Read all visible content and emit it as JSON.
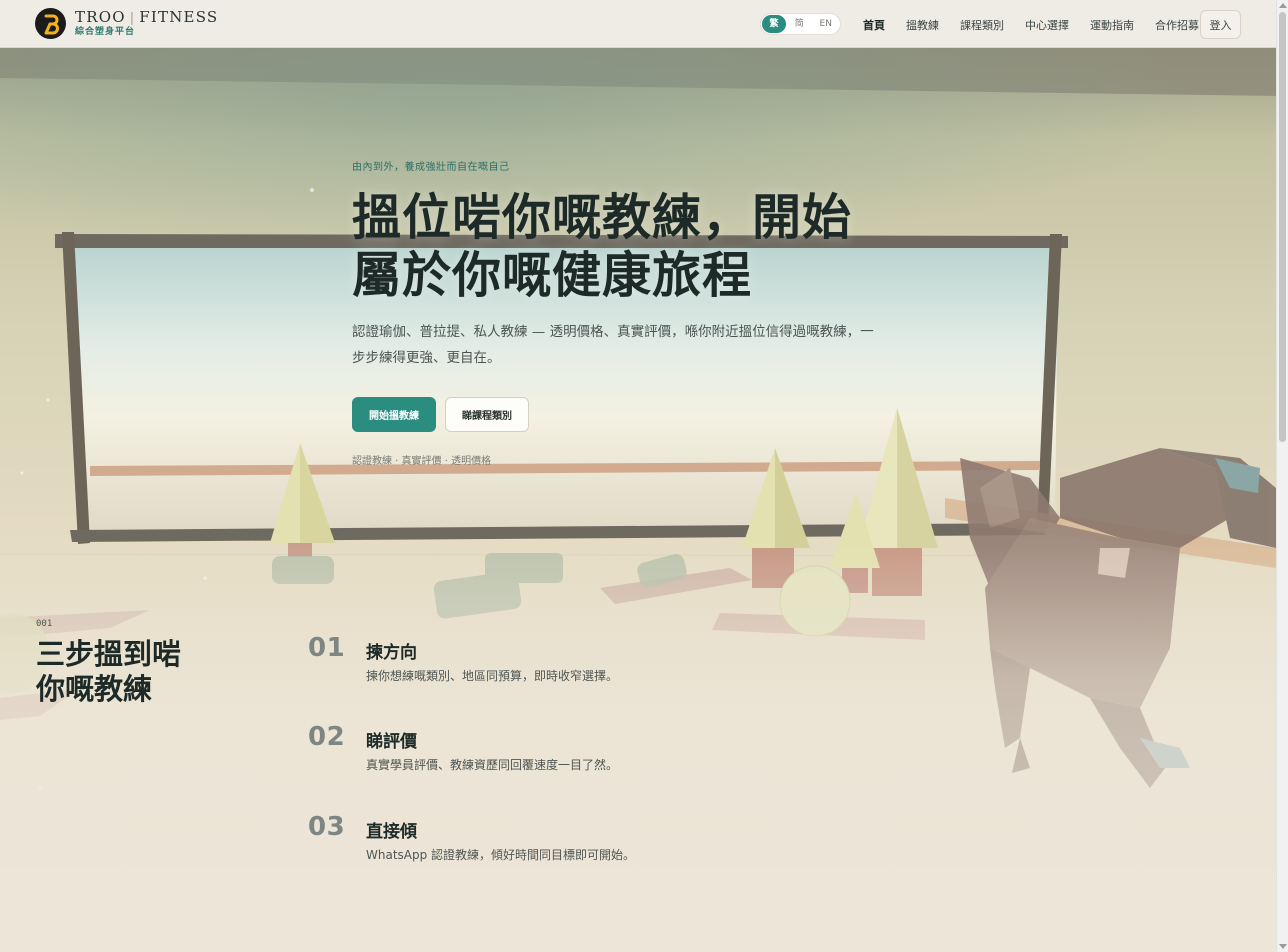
{
  "header": {
    "brand_name": "TROO",
    "brand_name2": "FITNESS",
    "brand_separator": "|",
    "brand_sub": "綜合塑身平台",
    "language": {
      "options": [
        "繁",
        "简",
        "EN"
      ],
      "selected": "繁"
    },
    "nav": [
      "首頁",
      "搵教練",
      "課程類別",
      "中心選擇",
      "運動指南",
      "合作招募"
    ],
    "login_label": "登入"
  },
  "hero": {
    "eyebrow": "由內到外，養成強壯而自在嘅自己",
    "title": "搵位啱你嘅教練，開始屬於你嘅健康旅程",
    "description": "認證瑜伽、普拉提、私人教練 — 透明價格、真實評價，喺你附近搵位信得過嘅教練，一步步練得更強、更自在。",
    "primary_cta": "開始搵教練",
    "secondary_cta": "睇課程類別",
    "trust_line": "認證教練 · 真實評價 · 透明價格"
  },
  "steps_section": {
    "number": "001",
    "title": "三步搵到啱你嘅教練",
    "steps": [
      {
        "num": "01",
        "title": "揀方向",
        "desc": "揀你想練嘅類別、地區同預算，即時收窄選擇。"
      },
      {
        "num": "02",
        "title": "睇評價",
        "desc": "真實學員評價、教練資歷同回覆速度一目了然。"
      },
      {
        "num": "03",
        "title": "直接傾",
        "desc": "WhatsApp 認證教練，傾好時間同目標即可開始。"
      }
    ]
  },
  "colors": {
    "accent": "#2b8c80",
    "logo_gold": "#f3b11e",
    "text_dark": "#1d2a27"
  }
}
